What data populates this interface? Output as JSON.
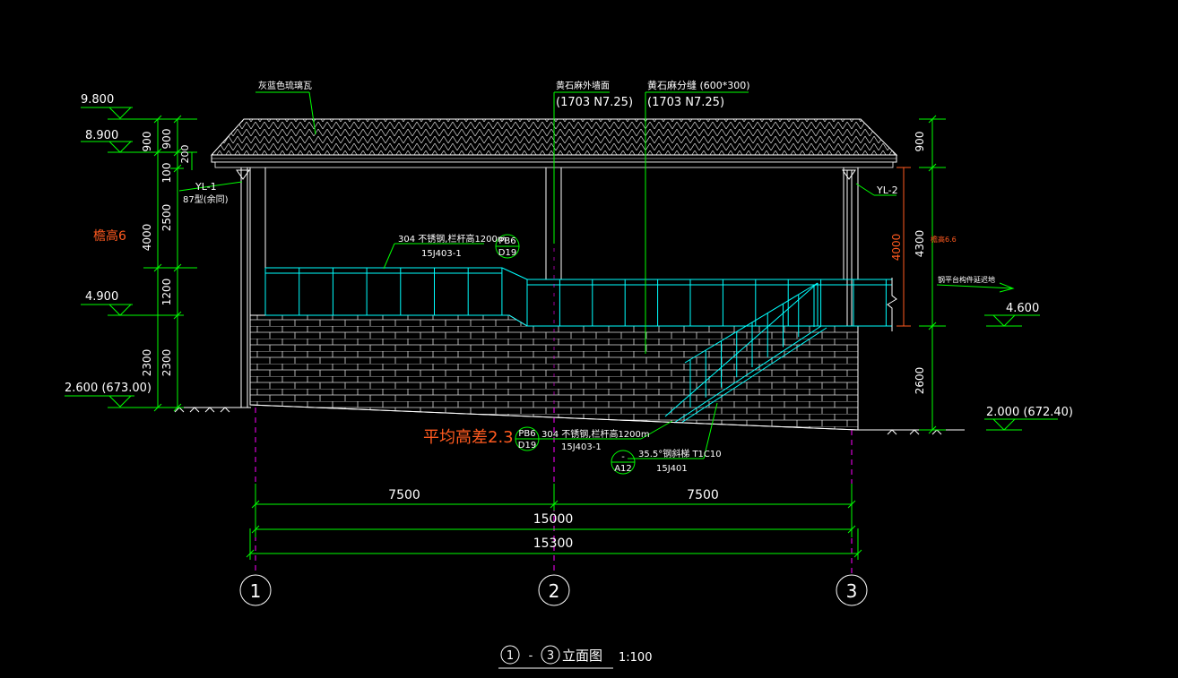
{
  "elevations_left": {
    "e9800": "9.800",
    "e8900": "8.900",
    "e4900": "4.900",
    "e2600": "2.600 (673.00)"
  },
  "elevations_right": {
    "e4600": "4.600",
    "e2000": "2.000 (672.40)"
  },
  "left_dims_outer": [
    "900",
    "4000",
    "2300"
  ],
  "left_dims_inner": [
    "900",
    "100",
    "2500",
    "1200",
    "2300"
  ],
  "left_dim_small": "200",
  "right_dims": [
    "900",
    "4300",
    "2600"
  ],
  "eave_height_label": "檐高6",
  "right_eave_label": "檐高6.6",
  "red_dim": "4000",
  "roof_note": "灰蓝色琉璃瓦",
  "wall_note": {
    "line1": "黄石麻外墙面",
    "line2": "(1703  N7.25)"
  },
  "stone_note": {
    "line1": "黄石麻分缝 (600*300)",
    "line2": "(1703  N7.25)"
  },
  "yl1": {
    "label": "YL-1",
    "sub": "87型(余同)"
  },
  "yl2": "YL-2",
  "railing_note_top": {
    "text": "304 不锈钢,栏杆高1200m",
    "ref": "15J403-1",
    "code_top": "PB6",
    "code_bottom": "D19"
  },
  "railing_note_bottom": {
    "text": "304 不锈钢,栏杆高1200m",
    "ref": "15J403-1",
    "code_top": "PB6",
    "code_bottom": "D19"
  },
  "stair_note": {
    "text": "35.5°钢斜梯 T1C10",
    "ref": "15J401",
    "code_top": "-",
    "code_bottom": "A12"
  },
  "platform_note": "钢平台构件延迟地",
  "avg_height_diff": "平均高差2.3",
  "dims_bottom": {
    "d1": "7500",
    "d2": "7500",
    "total1": "15000",
    "total2": "15300"
  },
  "axes": [
    "1",
    "2",
    "3"
  ],
  "title": {
    "a": "1",
    "sep": "-",
    "b": "3",
    "text": "立面图",
    "scale": "1:100"
  },
  "colors": {
    "bg": "#000000",
    "line": "#ffffff",
    "green": "#00ff00",
    "cyan": "#00ffff",
    "orange": "#ff5a1f",
    "magenta": "#ff00ff",
    "yellow": "#ffff00"
  }
}
